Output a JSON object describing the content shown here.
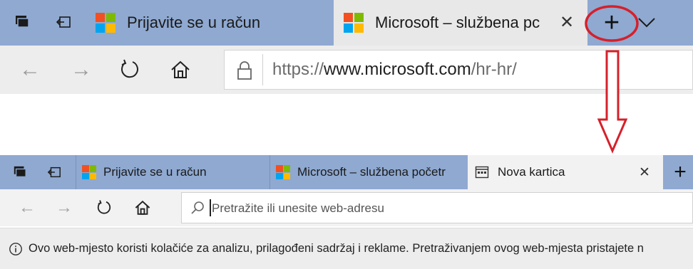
{
  "top_browser": {
    "tabs": [
      {
        "title": "Prijavite se u račun",
        "active": false
      },
      {
        "title": "Microsoft – službena pc",
        "active": true
      }
    ],
    "close_tab_glyph": "✕",
    "new_tab_glyph": "+",
    "chevron_glyph": "∨",
    "address": {
      "prefix": "https://",
      "domain": "www.microsoft.com",
      "path": "/hr-hr/"
    }
  },
  "bottom_browser": {
    "tabs": [
      {
        "title": "Prijavite se u račun",
        "active": false
      },
      {
        "title": "Microsoft – službena početr",
        "active": false
      },
      {
        "title": "Nova kartica",
        "active": true
      }
    ],
    "close_tab_glyph": "✕",
    "new_tab_glyph": "+",
    "address_placeholder": "Pretražite ili unesite web-adresu",
    "cookie_notice": "Ovo web-mjesto koristi kolačiće za analizu, prilagođeni sadržaj i reklame. Pretraživanjem ovog web-mjesta pristajete n"
  },
  "nav_glyphs": {
    "back": "←",
    "forward": "→",
    "refresh": "↻",
    "info": "ⓘ"
  },
  "colors": {
    "tabbar_blue": "#8fa9d1",
    "annotation_red": "#d6202a",
    "ms_red": "#f25022",
    "ms_green": "#7fba00",
    "ms_blue": "#00a4ef",
    "ms_yellow": "#ffb900"
  },
  "icons": [
    "tab-preview-icon",
    "set-aside-tabs-icon",
    "microsoft-logo-icon",
    "back-arrow-icon",
    "forward-arrow-icon",
    "refresh-icon",
    "home-icon",
    "lock-icon",
    "search-icon",
    "new-tab-page-icon",
    "info-icon",
    "red-circle-annotation",
    "red-down-arrow-annotation"
  ]
}
